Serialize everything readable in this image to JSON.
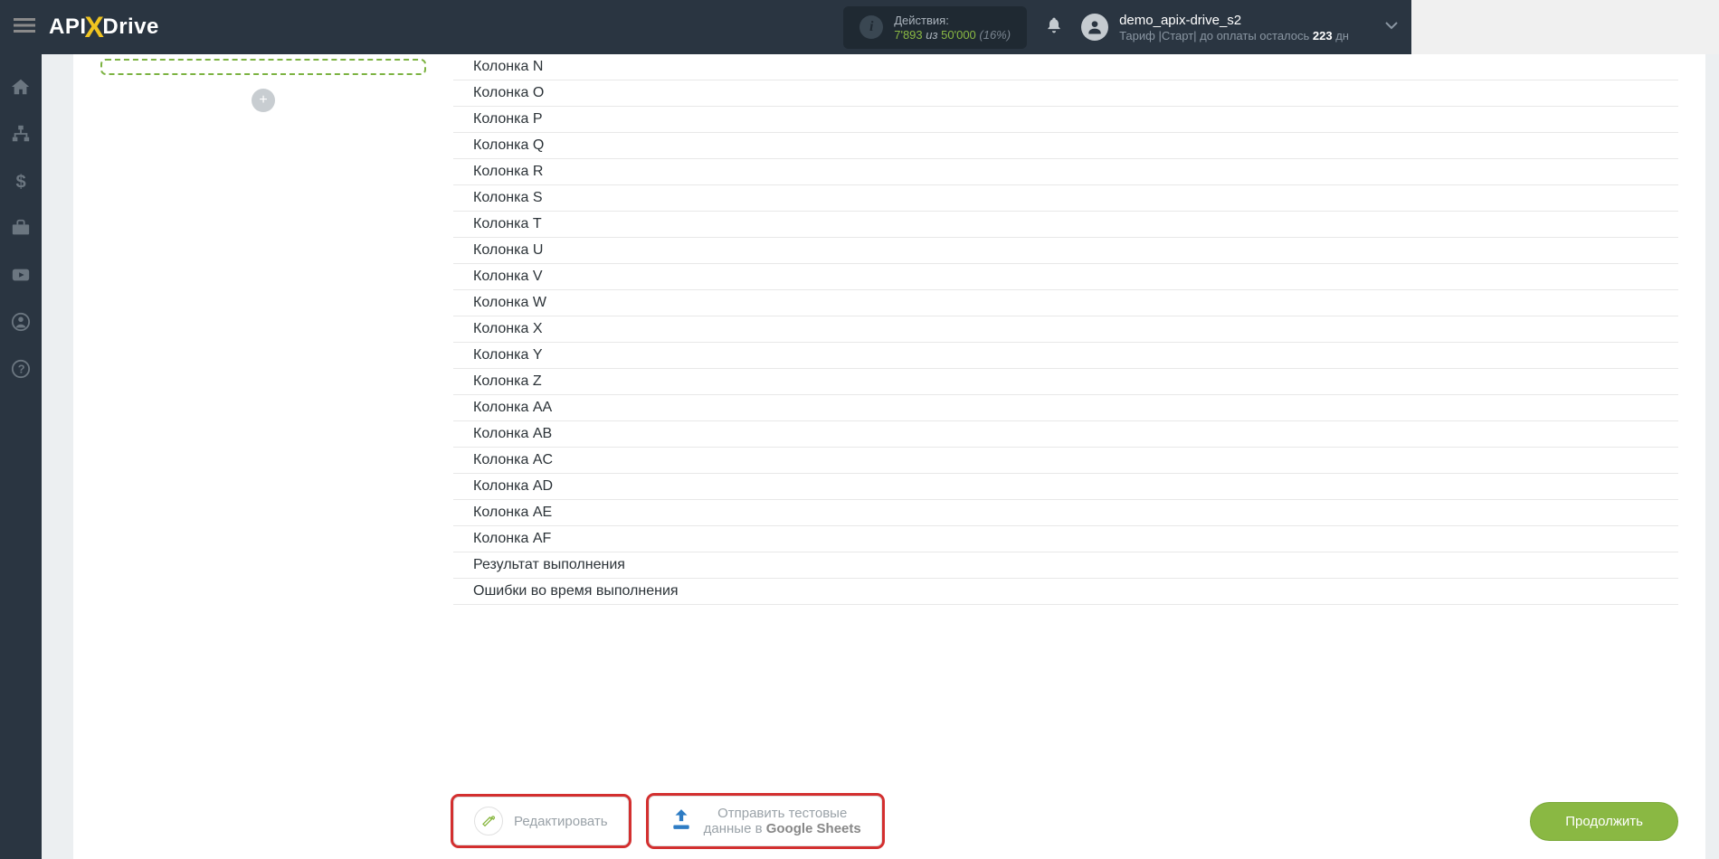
{
  "header": {
    "logo": {
      "api": "API",
      "drive": "Drive"
    },
    "actions": {
      "label": "Действия:",
      "used": "7'893",
      "of": " из ",
      "total": "50'000",
      "pct": " (16%)"
    },
    "user": {
      "name": "demo_apix-drive_s2",
      "plan_prefix": "Тариф |Старт| до оплаты осталось ",
      "days": "223",
      "plan_suffix": " дн"
    }
  },
  "columns": [
    "Колонка N",
    "Колонка O",
    "Колонка P",
    "Колонка Q",
    "Колонка R",
    "Колонка S",
    "Колонка T",
    "Колонка U",
    "Колонка V",
    "Колонка W",
    "Колонка X",
    "Колонка Y",
    "Колонка Z",
    "Колонка AA",
    "Колонка AB",
    "Колонка AC",
    "Колонка AD",
    "Колонка AE",
    "Колонка AF",
    "Результат выполнения",
    "Ошибки во время выполнения"
  ],
  "buttons": {
    "edit": "Редактировать",
    "send_line1": "Отправить тестовые",
    "send_line2a": "данные в ",
    "send_line2b": "Google Sheets",
    "continue": "Продолжить"
  }
}
